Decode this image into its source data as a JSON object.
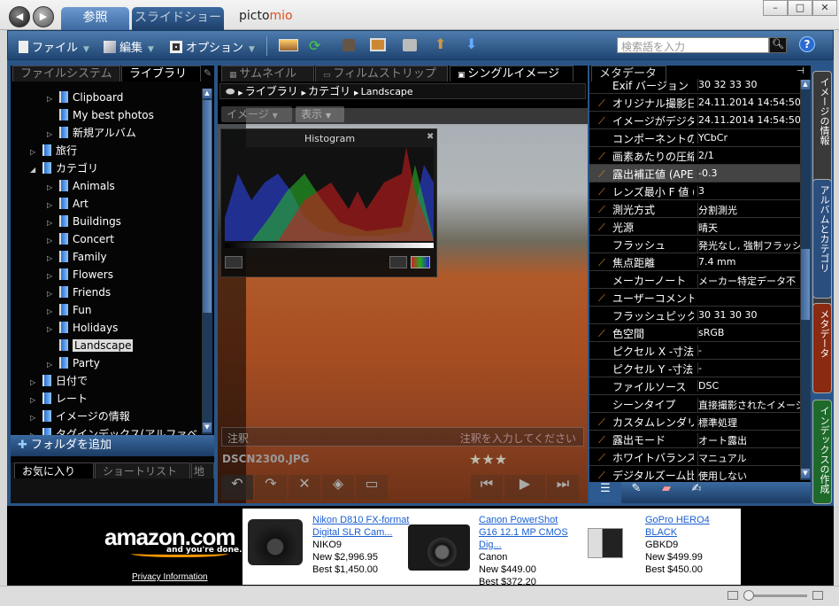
{
  "window": {
    "tabs": [
      "参照",
      "スライドショー"
    ],
    "logo": "pictomio",
    "controls": [
      "minimize",
      "maximize",
      "close"
    ]
  },
  "toolbar": {
    "file": "ファイル",
    "edit": "編集",
    "options": "オプション",
    "search_placeholder": "検索語を入力",
    "icons": [
      "import-icon",
      "sync-icon",
      "square-icon",
      "fullscreen-icon",
      "print-icon",
      "upload-icon",
      "download-icon"
    ]
  },
  "left": {
    "tabs": [
      "ファイルシステム",
      "ライブラリ"
    ],
    "tree": [
      {
        "label": "Clipboard",
        "level": 2,
        "arrow": true
      },
      {
        "label": "My best photos",
        "level": 2,
        "arrow": false
      },
      {
        "label": "新規アルバム",
        "level": 2,
        "arrow": true
      },
      {
        "label": "旅行",
        "level": 1,
        "arrow": true
      },
      {
        "label": "カテゴリ",
        "level": 1,
        "arrow": true,
        "expanded": true
      },
      {
        "label": "Animals",
        "level": 2,
        "arrow": true
      },
      {
        "label": "Art",
        "level": 2,
        "arrow": true
      },
      {
        "label": "Buildings",
        "level": 2,
        "arrow": true
      },
      {
        "label": "Concert",
        "level": 2,
        "arrow": true
      },
      {
        "label": "Family",
        "level": 2,
        "arrow": true
      },
      {
        "label": "Flowers",
        "level": 2,
        "arrow": true
      },
      {
        "label": "Friends",
        "level": 2,
        "arrow": true
      },
      {
        "label": "Fun",
        "level": 2,
        "arrow": true
      },
      {
        "label": "Holidays",
        "level": 2,
        "arrow": true
      },
      {
        "label": "Landscape",
        "level": 2,
        "arrow": false,
        "selected": true
      },
      {
        "label": "Party",
        "level": 2,
        "arrow": true
      },
      {
        "label": "日付で",
        "level": 1,
        "arrow": true
      },
      {
        "label": "レート",
        "level": 1,
        "arrow": true
      },
      {
        "label": "イメージの情報",
        "level": 1,
        "arrow": true
      },
      {
        "label": "タグインデックス(アルファベ",
        "level": 1,
        "arrow": true
      }
    ],
    "add_folder": "フォルダを追加",
    "bottom_tabs": [
      "お気に入り",
      "ショートリスト",
      "地球"
    ]
  },
  "center": {
    "tabs": [
      "サムネイル",
      "フィルムストリップ",
      "シングルイメージ"
    ],
    "breadcrumb": [
      "ライブラリ",
      "カテゴリ",
      "Landscape"
    ],
    "menus": [
      "イメージ",
      "表示"
    ],
    "histogram_title": "Histogram",
    "annotation_label": "注釈",
    "annotation_placeholder": "注釈を入力してください",
    "filename": "DSCN2300.JPG",
    "rating": 3
  },
  "meta": {
    "title": "メタデータ",
    "rows": [
      {
        "n": "Exif バージョン",
        "v": "30 32 33 30",
        "e": false
      },
      {
        "n": "オリジナル撮影日",
        "v": "24.11.2014 14:54:50",
        "e": true
      },
      {
        "n": "イメージがデジタ",
        "v": "24.11.2014 14:54:50",
        "e": true
      },
      {
        "n": "コンポーネントの",
        "v": "YCbCr",
        "e": false
      },
      {
        "n": "画素あたりの圧縮",
        "v": "2/1",
        "e": true
      },
      {
        "n": "露出補正値 (APEX",
        "v": "-0.3",
        "e": true,
        "sel": true
      },
      {
        "n": "レンズ最小 F 値 (",
        "v": "3",
        "e": true
      },
      {
        "n": "測光方式",
        "v": "分割測光",
        "e": true
      },
      {
        "n": "光源",
        "v": "晴天",
        "e": true
      },
      {
        "n": "フラッシュ",
        "v": "発光なし, 強制フラッシュ",
        "e": false
      },
      {
        "n": "焦点距離",
        "v": "7.4 mm",
        "e": true
      },
      {
        "n": "メーカーノート",
        "v": "メーカー特定データ不",
        "e": false
      },
      {
        "n": "ユーザーコメント",
        "v": "",
        "e": true
      },
      {
        "n": "フラッシュピックス",
        "v": "30 31 30 30",
        "e": false
      },
      {
        "n": "色空間",
        "v": "sRGB",
        "e": true
      },
      {
        "n": "ピクセル X -寸法",
        "v": "-",
        "e": false
      },
      {
        "n": "ピクセル Y -寸法",
        "v": "-",
        "e": false
      },
      {
        "n": "ファイルソース",
        "v": "DSC",
        "e": false
      },
      {
        "n": "シーンタイプ",
        "v": "直接撮影されたイメージ",
        "e": false
      },
      {
        "n": "カスタムレンダリング",
        "v": "標準処理",
        "e": true
      },
      {
        "n": "露出モード",
        "v": "オート露出",
        "e": true
      },
      {
        "n": "ホワイトバランス",
        "v": "マニュアル",
        "e": true
      },
      {
        "n": "デジタルズーム比",
        "v": "使用しない",
        "e": true
      }
    ],
    "side_tabs": [
      {
        "label": "イメージの情報",
        "color": "#3a3a3a"
      },
      {
        "label": "アルバムとカテゴリ",
        "color": "#2a4e7e"
      },
      {
        "label": "メタデータ",
        "color": "#8a2a10"
      },
      {
        "label": "インデックスの作成",
        "color": "#1e6a2a"
      }
    ]
  },
  "ad": {
    "brand": "amazon.com",
    "tagline": "and you're done.",
    "privacy": "Privacy Information",
    "items": [
      {
        "title1": "Nikon D810 FX-format",
        "title2": "Digital SLR Cam...",
        "seller": "NIKO9",
        "new": "New $2,996.95",
        "best": "Best $1,450.00"
      },
      {
        "title1": "Canon PowerShot",
        "title2": "G16 12.1 MP CMOS",
        "title3": "Dig...",
        "seller": "Canon",
        "new": "New $449.00",
        "best": "Best $372.20"
      },
      {
        "title1": "GoPro HERO4 BLACK",
        "seller": "GBKD9",
        "new": "New $499.99",
        "best": "Best $450.00"
      }
    ]
  }
}
